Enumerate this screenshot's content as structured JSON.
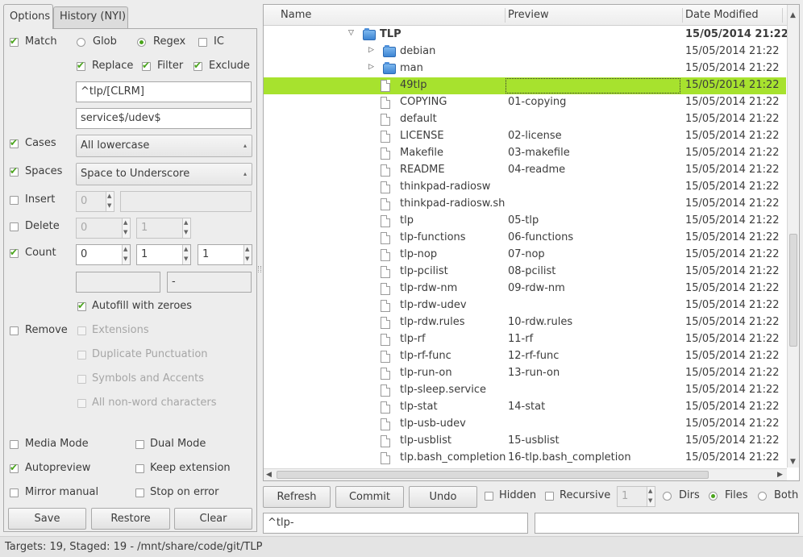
{
  "tabs": [
    {
      "label": "Options",
      "active": true
    },
    {
      "label": "History (NYI)",
      "active": false
    }
  ],
  "options": {
    "match": {
      "label": "Match",
      "checked": true
    },
    "glob": {
      "label": "Glob",
      "selected": false
    },
    "regex": {
      "label": "Regex",
      "selected": true
    },
    "ic": {
      "label": "IC",
      "checked": false
    },
    "replace": {
      "label": "Replace",
      "checked": true
    },
    "filter": {
      "label": "Filter",
      "checked": true
    },
    "exclude": {
      "label": "Exclude",
      "checked": true
    },
    "match_pattern": "^tlp/[CLRM]",
    "replace_pattern": "service$/udev$",
    "cases": {
      "label": "Cases",
      "checked": true,
      "value": "All lowercase"
    },
    "spaces": {
      "label": "Spaces",
      "checked": true,
      "value": "Space to Underscore"
    },
    "insert": {
      "label": "Insert",
      "checked": false,
      "position": "0",
      "text": ""
    },
    "delete": {
      "label": "Delete",
      "checked": false,
      "from": "0",
      "to": "1"
    },
    "count": {
      "label": "Count",
      "checked": true,
      "start": "0",
      "step": "1",
      "digits": "1",
      "prefix": "",
      "suffix": "-"
    },
    "autofill": {
      "label": "Autofill with zeroes",
      "checked": true
    },
    "remove": {
      "label": "Remove",
      "checked": false
    },
    "extensions": {
      "label": "Extensions"
    },
    "dup_punct": {
      "label": "Duplicate Punctuation"
    },
    "symbols": {
      "label": "Symbols and Accents"
    },
    "nonword": {
      "label": "All non-word characters"
    },
    "media_mode": {
      "label": "Media Mode",
      "checked": false
    },
    "dual_mode": {
      "label": "Dual Mode",
      "checked": false
    },
    "autopreview": {
      "label": "Autopreview",
      "checked": true
    },
    "keep_ext": {
      "label": "Keep extension",
      "checked": false
    },
    "mirror": {
      "label": "Mirror manual",
      "checked": false
    },
    "stop_error": {
      "label": "Stop on error",
      "checked": false
    }
  },
  "left_buttons": {
    "save": "Save",
    "restore": "Restore",
    "clear": "Clear"
  },
  "columns": {
    "name": "Name",
    "preview": "Preview",
    "date": "Date Modified"
  },
  "files": [
    {
      "name": "TLP",
      "preview": "",
      "date": "15/05/2014 21:22",
      "type": "folder",
      "level": 0,
      "expanded": true
    },
    {
      "name": "debian",
      "preview": "",
      "date": "15/05/2014 21:22",
      "type": "folder",
      "level": 1,
      "expanded": false
    },
    {
      "name": "man",
      "preview": "",
      "date": "15/05/2014 21:22",
      "type": "folder",
      "level": 1,
      "expanded": false
    },
    {
      "name": "49tlp",
      "preview": "",
      "date": "15/05/2014 21:22",
      "type": "file",
      "level": 1,
      "selected": true
    },
    {
      "name": "COPYING",
      "preview": "01-copying",
      "date": "15/05/2014 21:22",
      "type": "file",
      "level": 1
    },
    {
      "name": "default",
      "preview": "",
      "date": "15/05/2014 21:22",
      "type": "file",
      "level": 1
    },
    {
      "name": "LICENSE",
      "preview": "02-license",
      "date": "15/05/2014 21:22",
      "type": "file",
      "level": 1
    },
    {
      "name": "Makefile",
      "preview": "03-makefile",
      "date": "15/05/2014 21:22",
      "type": "file",
      "level": 1
    },
    {
      "name": "README",
      "preview": "04-readme",
      "date": "15/05/2014 21:22",
      "type": "file",
      "level": 1
    },
    {
      "name": "thinkpad-radiosw",
      "preview": "",
      "date": "15/05/2014 21:22",
      "type": "file",
      "level": 1
    },
    {
      "name": "thinkpad-radiosw.sh",
      "preview": "",
      "date": "15/05/2014 21:22",
      "type": "file",
      "level": 1
    },
    {
      "name": "tlp",
      "preview": "05-tlp",
      "date": "15/05/2014 21:22",
      "type": "file",
      "level": 1
    },
    {
      "name": "tlp-functions",
      "preview": "06-functions",
      "date": "15/05/2014 21:22",
      "type": "file",
      "level": 1
    },
    {
      "name": "tlp-nop",
      "preview": "07-nop",
      "date": "15/05/2014 21:22",
      "type": "file",
      "level": 1
    },
    {
      "name": "tlp-pcilist",
      "preview": "08-pcilist",
      "date": "15/05/2014 21:22",
      "type": "file",
      "level": 1
    },
    {
      "name": "tlp-rdw-nm",
      "preview": "09-rdw-nm",
      "date": "15/05/2014 21:22",
      "type": "file",
      "level": 1
    },
    {
      "name": "tlp-rdw-udev",
      "preview": "",
      "date": "15/05/2014 21:22",
      "type": "file",
      "level": 1
    },
    {
      "name": "tlp-rdw.rules",
      "preview": "10-rdw.rules",
      "date": "15/05/2014 21:22",
      "type": "file",
      "level": 1
    },
    {
      "name": "tlp-rf",
      "preview": "11-rf",
      "date": "15/05/2014 21:22",
      "type": "file",
      "level": 1
    },
    {
      "name": "tlp-rf-func",
      "preview": "12-rf-func",
      "date": "15/05/2014 21:22",
      "type": "file",
      "level": 1
    },
    {
      "name": "tlp-run-on",
      "preview": "13-run-on",
      "date": "15/05/2014 21:22",
      "type": "file",
      "level": 1
    },
    {
      "name": "tlp-sleep.service",
      "preview": "",
      "date": "15/05/2014 21:22",
      "type": "file",
      "level": 1
    },
    {
      "name": "tlp-stat",
      "preview": "14-stat",
      "date": "15/05/2014 21:22",
      "type": "file",
      "level": 1
    },
    {
      "name": "tlp-usb-udev",
      "preview": "",
      "date": "15/05/2014 21:22",
      "type": "file",
      "level": 1
    },
    {
      "name": "tlp-usblist",
      "preview": "15-usblist",
      "date": "15/05/2014 21:22",
      "type": "file",
      "level": 1
    },
    {
      "name": "tlp.bash_completion",
      "preview": "16-tlp.bash_completion",
      "date": "15/05/2014 21:22",
      "type": "file",
      "level": 1
    }
  ],
  "bottom": {
    "refresh": "Refresh",
    "commit": "Commit",
    "undo": "Undo",
    "hidden": {
      "label": "Hidden",
      "checked": false
    },
    "recursive": {
      "label": "Recursive",
      "checked": false
    },
    "depth": "1",
    "dirs": {
      "label": "Dirs",
      "selected": false
    },
    "files": {
      "label": "Files",
      "selected": true
    },
    "both": {
      "label": "Both",
      "selected": false
    },
    "path_filter": "^tlp-",
    "second_filter": ""
  },
  "status": "Targets: 19, Staged: 19 - /mnt/share/code/git/TLP",
  "colors": {
    "selection": "#a7e22e",
    "check": "#4aa41c",
    "folder": "#3d85d3"
  }
}
